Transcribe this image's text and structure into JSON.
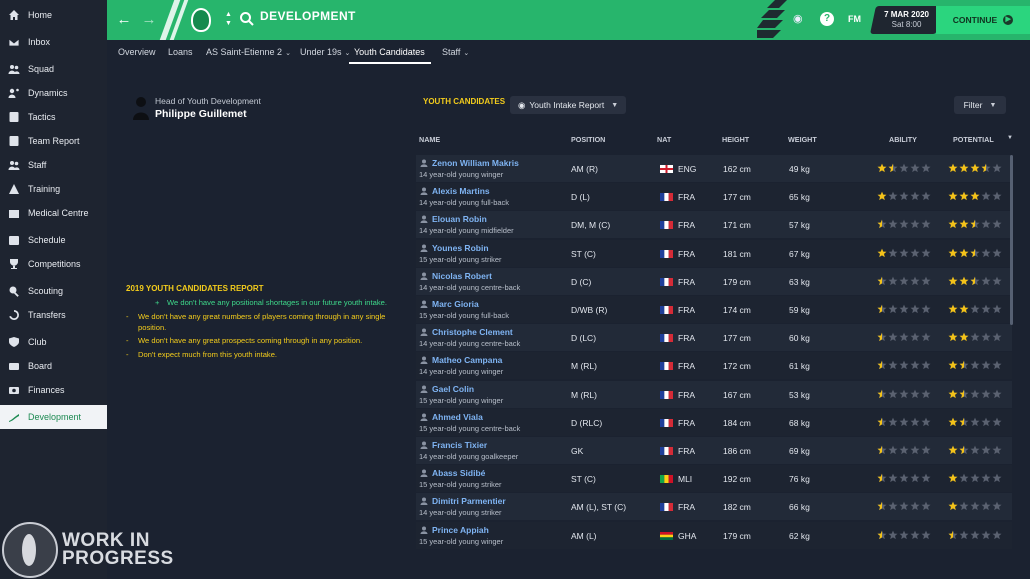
{
  "sidebar": {
    "items": [
      {
        "label": "Home",
        "icon": "home-icon",
        "active": false
      },
      {
        "label": "Inbox",
        "icon": "inbox-icon",
        "active": false
      },
      {
        "label": "Squad",
        "icon": "squad-icon",
        "active": false
      },
      {
        "label": "Dynamics",
        "icon": "dynamics-icon",
        "active": false
      },
      {
        "label": "Tactics",
        "icon": "tactics-icon",
        "active": false
      },
      {
        "label": "Team Report",
        "icon": "team-report-icon",
        "active": false
      },
      {
        "label": "Staff",
        "icon": "staff-icon",
        "active": false
      },
      {
        "label": "Training",
        "icon": "training-icon",
        "active": false
      },
      {
        "label": "Medical Centre",
        "icon": "medical-icon",
        "active": false
      },
      {
        "label": "Schedule",
        "icon": "schedule-icon",
        "active": false
      },
      {
        "label": "Competitions",
        "icon": "trophy-icon",
        "active": false
      },
      {
        "label": "Scouting",
        "icon": "scouting-icon",
        "active": false
      },
      {
        "label": "Transfers",
        "icon": "transfers-icon",
        "active": false
      },
      {
        "label": "Club",
        "icon": "club-icon",
        "active": false
      },
      {
        "label": "Board",
        "icon": "board-icon",
        "active": false
      },
      {
        "label": "Finances",
        "icon": "finances-icon",
        "active": false
      },
      {
        "label": "Development",
        "icon": "development-icon",
        "active": true
      }
    ]
  },
  "watermark": {
    "line1": "WORK IN",
    "line2": "PROGRESS"
  },
  "header": {
    "title": "DEVELOPMENT",
    "fm_label": "FM",
    "date": "7 MAR 2020",
    "time": "Sat 8:00",
    "continue_label": "CONTINUE",
    "help_label": "?"
  },
  "tabs": [
    {
      "label": "Overview",
      "active": false,
      "dropdown": false
    },
    {
      "label": "Loans",
      "active": false,
      "dropdown": false
    },
    {
      "label": "AS Saint-Etienne 2",
      "active": false,
      "dropdown": true
    },
    {
      "label": "Under 19s",
      "active": false,
      "dropdown": true
    },
    {
      "label": "Youth Candidates",
      "active": true,
      "dropdown": false
    },
    {
      "label": "Staff",
      "active": false,
      "dropdown": true
    }
  ],
  "staff": {
    "role": "Head of Youth Development",
    "name": "Philippe Guillemet"
  },
  "report": {
    "title": "2019 YOUTH CANDIDATES REPORT",
    "lines": [
      {
        "bullet": "+",
        "text": "We don't have any positional shortages in our future youth intake.",
        "positive": true
      },
      {
        "bullet": "-",
        "text": "We don't have any great numbers of players coming through in any single position.",
        "positive": false
      },
      {
        "bullet": "-",
        "text": "We don't have any great prospects coming through in any position.",
        "positive": false
      },
      {
        "bullet": "-",
        "text": "Don't expect much from this youth intake.",
        "positive": false
      }
    ]
  },
  "candidates": {
    "label": "YOUTH CANDIDATES",
    "view_label": "Youth Intake Report",
    "filter_label": "Filter",
    "columns": {
      "name": "NAME",
      "position": "POSITION",
      "nat": "NAT",
      "height": "HEIGHT",
      "weight": "WEIGHT",
      "ability": "ABILITY",
      "potential": "POTENTIAL"
    },
    "colors": {
      "star_gold": "#f3c21a",
      "star_empty": "#5a6170",
      "name_blue": "#7fb4f3"
    },
    "rows": [
      {
        "name": "Zenon William Makris",
        "desc": "14 year-old young winger",
        "position": "AM (R)",
        "nat": "ENG",
        "flag": "eng",
        "height": "162 cm",
        "weight": "49 kg",
        "ability": 1.5,
        "potential": 3.5
      },
      {
        "name": "Alexis Martins",
        "desc": "14 year-old young full-back",
        "position": "D (L)",
        "nat": "FRA",
        "flag": "fra",
        "height": "177 cm",
        "weight": "65 kg",
        "ability": 1,
        "potential": 3
      },
      {
        "name": "Elouan Robin",
        "desc": "14 year-old young midfielder",
        "position": "DM, M (C)",
        "nat": "FRA",
        "flag": "fra",
        "height": "171 cm",
        "weight": "57 kg",
        "ability": 0.5,
        "potential": 2.5
      },
      {
        "name": "Younes Robin",
        "desc": "15 year-old young striker",
        "position": "ST (C)",
        "nat": "FRA",
        "flag": "fra",
        "height": "181 cm",
        "weight": "67 kg",
        "ability": 1,
        "potential": 2.5
      },
      {
        "name": "Nicolas Robert",
        "desc": "14 year-old young centre-back",
        "position": "D (C)",
        "nat": "FRA",
        "flag": "fra",
        "height": "179 cm",
        "weight": "63 kg",
        "ability": 0.5,
        "potential": 2.5
      },
      {
        "name": "Marc Gioria",
        "desc": "15 year-old young full-back",
        "position": "D/WB (R)",
        "nat": "FRA",
        "flag": "fra",
        "height": "174 cm",
        "weight": "59 kg",
        "ability": 0.5,
        "potential": 2
      },
      {
        "name": "Christophe Clement",
        "desc": "14 year-old young centre-back",
        "position": "D (LC)",
        "nat": "FRA",
        "flag": "fra",
        "height": "177 cm",
        "weight": "60 kg",
        "ability": 0.5,
        "potential": 2
      },
      {
        "name": "Matheo Campana",
        "desc": "14 year-old young winger",
        "position": "M (RL)",
        "nat": "FRA",
        "flag": "fra",
        "height": "172 cm",
        "weight": "61 kg",
        "ability": 0.5,
        "potential": 1.5
      },
      {
        "name": "Gael Colin",
        "desc": "15 year-old young winger",
        "position": "M (RL)",
        "nat": "FRA",
        "flag": "fra",
        "height": "167 cm",
        "weight": "53 kg",
        "ability": 0.5,
        "potential": 1.5
      },
      {
        "name": "Ahmed Viala",
        "desc": "15 year-old young centre-back",
        "position": "D (RLC)",
        "nat": "FRA",
        "flag": "fra",
        "height": "184 cm",
        "weight": "68 kg",
        "ability": 0.5,
        "potential": 1.5
      },
      {
        "name": "Francis Tixier",
        "desc": "14 year-old young goalkeeper",
        "position": "GK",
        "nat": "FRA",
        "flag": "fra",
        "height": "186 cm",
        "weight": "69 kg",
        "ability": 0.5,
        "potential": 1.5
      },
      {
        "name": "Abass Sidibé",
        "desc": "15 year-old young striker",
        "position": "ST (C)",
        "nat": "MLI",
        "flag": "mli",
        "height": "192 cm",
        "weight": "76 kg",
        "ability": 0.5,
        "potential": 1
      },
      {
        "name": "Dimitri Parmentier",
        "desc": "14 year-old young striker",
        "position": "AM (L), ST (C)",
        "nat": "FRA",
        "flag": "fra",
        "height": "182 cm",
        "weight": "66 kg",
        "ability": 0.5,
        "potential": 1
      },
      {
        "name": "Prince Appiah",
        "desc": "15 year-old young winger",
        "position": "AM (L)",
        "nat": "GHA",
        "flag": "gha",
        "height": "179 cm",
        "weight": "62 kg",
        "ability": 0.5,
        "potential": 0.5
      }
    ]
  }
}
